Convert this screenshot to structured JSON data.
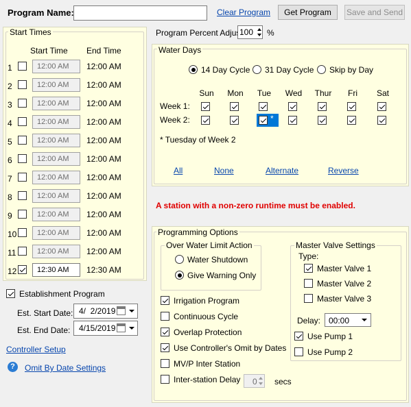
{
  "header": {
    "program_name_label": "Program Name:",
    "program_name_value": "",
    "clear_program": "Clear Program",
    "get_program": "Get Program",
    "save_and_send": "Save and Send",
    "percent_adjust_label": "Program Percent Adjust",
    "percent_adjust_value": "100",
    "percent_sign": "%"
  },
  "start_times": {
    "title": "Start Times",
    "col_start": "Start Time",
    "col_end": "End Time",
    "rows": [
      {
        "num": "1",
        "checked": false,
        "start": "12:00 AM",
        "end": "12:00 AM"
      },
      {
        "num": "2",
        "checked": false,
        "start": "12:00 AM",
        "end": "12:00 AM"
      },
      {
        "num": "3",
        "checked": false,
        "start": "12:00 AM",
        "end": "12:00 AM"
      },
      {
        "num": "4",
        "checked": false,
        "start": "12:00 AM",
        "end": "12:00 AM"
      },
      {
        "num": "5",
        "checked": false,
        "start": "12:00 AM",
        "end": "12:00 AM"
      },
      {
        "num": "6",
        "checked": false,
        "start": "12:00 AM",
        "end": "12:00 AM"
      },
      {
        "num": "7",
        "checked": false,
        "start": "12:00 AM",
        "end": "12:00 AM"
      },
      {
        "num": "8",
        "checked": false,
        "start": "12:00 AM",
        "end": "12:00 AM"
      },
      {
        "num": "9",
        "checked": false,
        "start": "12:00 AM",
        "end": "12:00 AM"
      },
      {
        "num": "10",
        "checked": false,
        "start": "12:00 AM",
        "end": "12:00 AM"
      },
      {
        "num": "11",
        "checked": false,
        "start": "12:00 AM",
        "end": "12:00 AM"
      },
      {
        "num": "12",
        "checked": true,
        "start": "12:30 AM",
        "end": "12:30 AM"
      }
    ]
  },
  "establishment": {
    "label": "Establishment Program",
    "checked": true,
    "start_label": "Est. Start Date:",
    "start_value": "4/  2/2019",
    "end_label": "Est. End Date:",
    "end_value": "4/15/2019"
  },
  "links": {
    "controller_setup": "Controller Setup",
    "omit_by_date": "Omit By Date Settings",
    "help_glyph": "?"
  },
  "water_days": {
    "title": "Water Days",
    "cycles": [
      {
        "label": "14 Day Cycle",
        "selected": true
      },
      {
        "label": "31 Day Cycle",
        "selected": false
      },
      {
        "label": "Skip by Day",
        "selected": false
      }
    ],
    "days": [
      "Sun",
      "Mon",
      "Tue",
      "Wed",
      "Thur",
      "Fri",
      "Sat"
    ],
    "weeks": [
      {
        "label": "Week 1:",
        "checks": [
          true,
          true,
          true,
          true,
          true,
          true,
          true
        ]
      },
      {
        "label": "Week 2:",
        "checks": [
          true,
          true,
          true,
          true,
          true,
          true,
          true
        ]
      }
    ],
    "marker": "*",
    "note": "* Tuesday of Week 2",
    "links": [
      "All",
      "None",
      "Alternate",
      "Reverse"
    ]
  },
  "error_message": "A station with a non-zero runtime must be enabled.",
  "programming_options": {
    "title": "Programming Options",
    "over_water": {
      "title": "Over Water Limit Action",
      "options": [
        {
          "label": "Water Shutdown",
          "selected": false
        },
        {
          "label": "Give Warning Only",
          "selected": true
        }
      ]
    },
    "checks": [
      {
        "label": "Irrigation Program",
        "checked": true
      },
      {
        "label": "Continuous Cycle",
        "checked": false
      },
      {
        "label": "Overlap Protection",
        "checked": true
      },
      {
        "label": "Use Controller's Omit by Dates",
        "checked": true
      },
      {
        "label": "MV/P Inter Station",
        "checked": false
      },
      {
        "label": "Inter-station Delay",
        "checked": false
      }
    ],
    "delay_value": "0",
    "delay_unit": "secs",
    "master_valve": {
      "title": "Master Valve Settings",
      "type_label": "Type:",
      "valves": [
        {
          "label": "Master Valve 1",
          "checked": true
        },
        {
          "label": "Master Valve 2",
          "checked": false
        },
        {
          "label": "Master Valve 3",
          "checked": false
        }
      ],
      "delay_label": "Delay:",
      "delay_value": "00:00",
      "pumps": [
        {
          "label": "Use Pump 1",
          "checked": true
        },
        {
          "label": "Use Pump 2",
          "checked": false
        }
      ]
    }
  }
}
